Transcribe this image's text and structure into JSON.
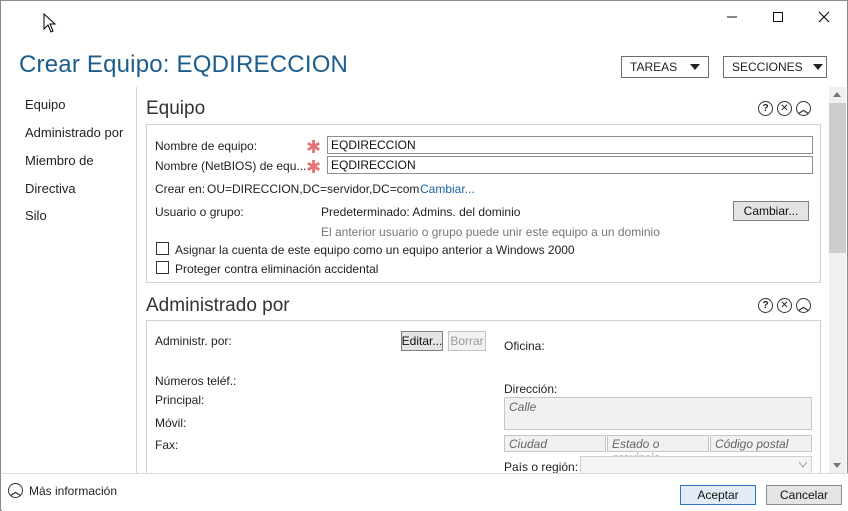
{
  "header": {
    "title": "Crear Equipo: EQDIRECCION",
    "tareas_label": "TAREAS",
    "secciones_label": "SECCIONES"
  },
  "nav": {
    "items": [
      "Equipo",
      "Administrado por",
      "Miembro de",
      "Directiva",
      "Silo"
    ]
  },
  "equipo": {
    "title": "Equipo",
    "nombre_label": "Nombre de equipo:",
    "nombre_value": "EQDIRECCION",
    "netbios_label": "Nombre (NetBIOS) de equ...",
    "netbios_value": "EQDIRECCION",
    "crear_en_label": "Crear en:",
    "crear_en_value": "OU=DIRECCION,DC=servidor,DC=com",
    "cambiar_link": "Cambiar...",
    "usuario_label": "Usuario o grupo:",
    "usuario_value": "Predeterminado: Admins. del dominio",
    "usuario_hint": "El anterior usuario o grupo puede unir este equipo a un dominio",
    "cambiar_button": "Cambiar...",
    "chk_win2000": "Asignar la cuenta de este equipo como un equipo anterior a Windows 2000",
    "chk_proteger": "Proteger contra eliminación accidental"
  },
  "administrado": {
    "title": "Administrado por",
    "admin_label": "Administr. por:",
    "editar_button": "Editar...",
    "borrar_button": "Borrar",
    "oficina_label": "Oficina:",
    "numeros_label": "Números teléf.:",
    "principal_label": "Principal:",
    "movil_label": "Móvil:",
    "fax_label": "Fax:",
    "direccion_label": "Dirección:",
    "calle_placeholder": "Calle",
    "ciudad_placeholder": "Ciudad",
    "estado_placeholder": "Estado o provincia",
    "postal_placeholder": "Código postal",
    "pais_label": "País o región:"
  },
  "footer": {
    "more_info": "Más información",
    "aceptar": "Aceptar",
    "cancelar": "Cancelar"
  }
}
